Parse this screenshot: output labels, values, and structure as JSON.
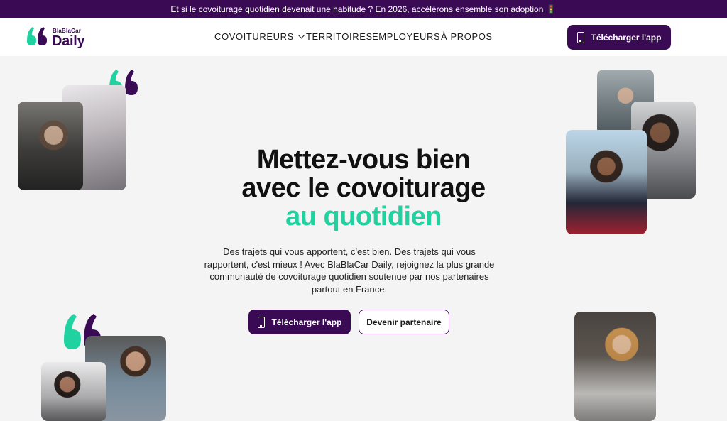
{
  "announcement": "Et si le covoiturage quotidien devenait une habitude ? En 2026, accélérons ensemble son adoption 🚦",
  "logo": {
    "small": "BlaBlaCar",
    "big": "Daily"
  },
  "nav": [
    {
      "label": "COVOITUREURS",
      "has_dropdown": true
    },
    {
      "label": "TERRITOIRES"
    },
    {
      "label": "EMPLOYEURS"
    },
    {
      "label": "À PROPOS"
    }
  ],
  "header_cta": "Télécharger l'app",
  "hero": {
    "line1": "Mettez-vous bien",
    "line2": "avec le covoiturage",
    "line3": "au quotidien",
    "lead": "Des trajets qui vous apportent, c'est bien. Des trajets qui vous rapportent, c'est mieux ! Avec BlaBlaCar Daily, rejoignez la plus grande communauté de covoiturage quotidien soutenue par nos partenaires partout en France.",
    "cta_primary": "Télécharger l'app",
    "cta_secondary": "Devenir partenaire"
  },
  "colors": {
    "brand": "#3a0a55",
    "accent": "#20d2a0"
  }
}
